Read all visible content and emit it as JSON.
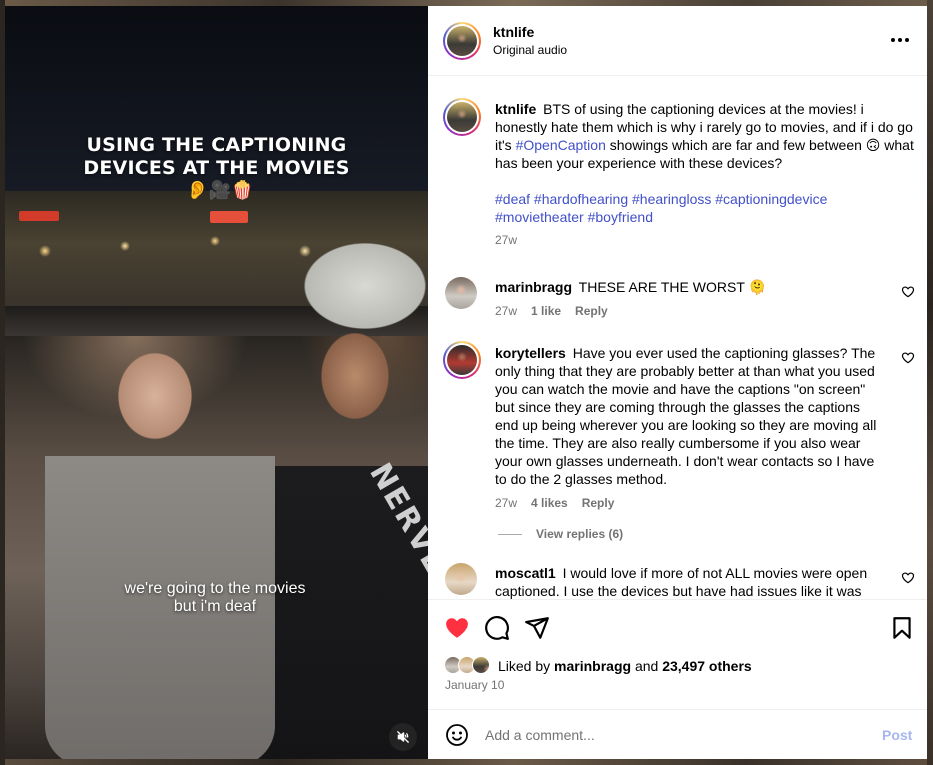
{
  "media": {
    "headline_line1": "USING THE CAPTIONING",
    "headline_line2": "DEVICES AT THE MOVIES",
    "emojis": "👂🎥🍿",
    "subtitle_line1": "we're going to the movies",
    "subtitle_line2": "but i'm deaf",
    "shirt_text": "NERVE"
  },
  "header": {
    "username": "ktnlife",
    "audio": "Original audio"
  },
  "caption": {
    "username": "ktnlife",
    "text_before": "BTS of using the captioning devices at the movies! i honestly hate them which is why i rarely go to movies, and if i do go it's",
    "hashtag_inline": "#OpenCaption",
    "text_after": "showings which are far and few between 🙃 what has been your experience with these devices?",
    "hashtags_line1": "#deaf #hardofhearing #hearingloss #captioningdevice",
    "hashtags_line2": "#movietheater #boyfriend",
    "time": "27w"
  },
  "comments": [
    {
      "username": "marinbragg",
      "text": "THESE ARE THE WORST 🫠",
      "time": "27w",
      "likes": "1 like",
      "reply": "Reply"
    },
    {
      "username": "korytellers",
      "text": "Have you ever used the captioning glasses? The only thing that they are probably better at than what you used you can watch the movie and have the captions \"on screen\" but since they are coming through the glasses the captions end up being wherever you are looking so they are moving all the time. They are also really cumbersome if you also wear your own glasses underneath. I don't wear contacts so I have to do the 2 glasses method.",
      "time": "27w",
      "likes": "4 likes",
      "reply": "Reply",
      "view_replies": "View replies (6)"
    },
    {
      "username": "moscatl1",
      "text": "I would love if more of not ALL movies were open captioned. I use the devices but have had issues like it was"
    }
  ],
  "likes": {
    "prefix": "Liked by",
    "user": "marinbragg",
    "and": "and",
    "others": "23,497 others",
    "date": "January 10"
  },
  "add_comment": {
    "placeholder": "Add a comment...",
    "post": "Post"
  },
  "colors": {
    "heart": "#ff3040",
    "link": "#4150c9",
    "post_disabled": "#a7b6f3"
  }
}
